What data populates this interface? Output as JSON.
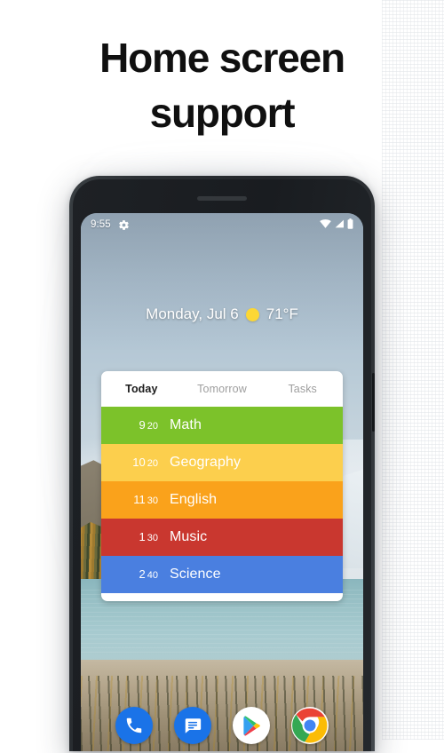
{
  "promo": {
    "heading": "Home screen\nsupport"
  },
  "phone": {
    "status_bar": {
      "clock": "9:55",
      "gear_icon": "gear-icon",
      "wifi_icon": "wifi-icon",
      "signal_icon": "cell-signal-icon",
      "battery_icon": "battery-icon"
    },
    "home": {
      "date": "Monday, Jul 6",
      "weather_icon": "sun-icon",
      "temperature": "71°F"
    },
    "widget": {
      "tabs": [
        {
          "label": "Today",
          "active": true
        },
        {
          "label": "Tomorrow",
          "active": false
        },
        {
          "label": "Tasks",
          "active": false
        }
      ],
      "rows": [
        {
          "hour": "9",
          "minute": "20",
          "title": "Math",
          "color": "#7cc22a"
        },
        {
          "hour": "10",
          "minute": "20",
          "title": "Geography",
          "color": "#fccf4d"
        },
        {
          "hour": "11",
          "minute": "30",
          "title": "English",
          "color": "#faa21b"
        },
        {
          "hour": "1",
          "minute": "30",
          "title": "Music",
          "color": "#c9372f"
        },
        {
          "hour": "2",
          "minute": "40",
          "title": "Science",
          "color": "#4a7fe0"
        }
      ]
    },
    "dock": [
      {
        "name": "phone-app",
        "label": "Phone"
      },
      {
        "name": "messages-app",
        "label": "Messages"
      },
      {
        "name": "play-store-app",
        "label": "Play Store"
      },
      {
        "name": "chrome-app",
        "label": "Chrome"
      }
    ]
  },
  "colors": {
    "page_background": "#ffffff",
    "heading": "#101010",
    "tab_active": "#1b1b1b",
    "tab_inactive": "#9e9e9e",
    "accent_blue": "#1a73e8"
  }
}
